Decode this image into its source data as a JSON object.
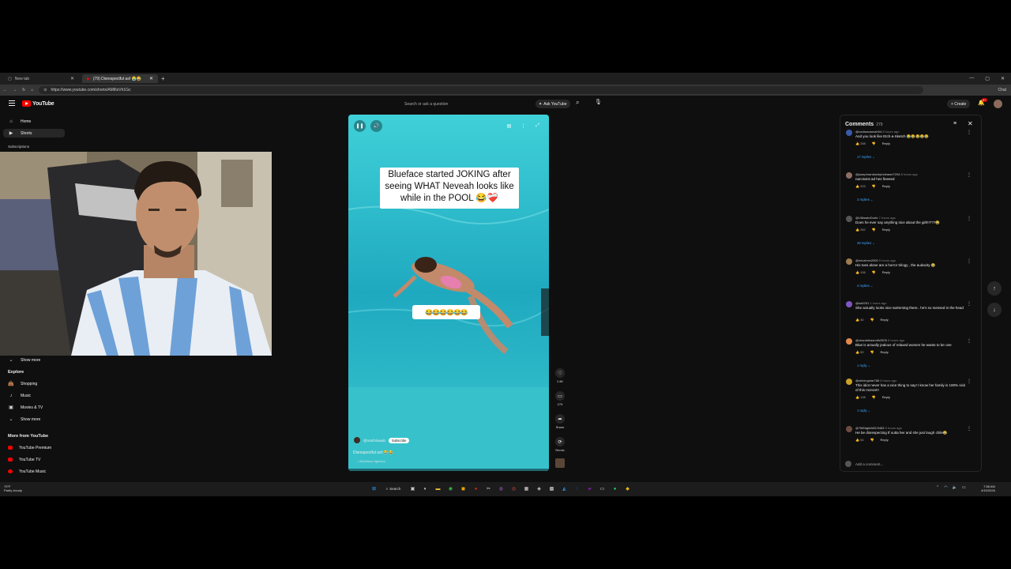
{
  "browser": {
    "tabs": [
      {
        "label": "New tab",
        "active": false
      },
      {
        "label": "(79) Disrespectful asf 😭😂",
        "active": true
      }
    ],
    "url": "https://www.youtube.com/shorts/AMl6sVh1Gc",
    "chat_label": "Chat"
  },
  "header": {
    "logo_text": "YouTube",
    "search_placeholder": "Search or ask a question",
    "ask_label": "Ask YouTube",
    "create_label": "+ Create",
    "notification_count": "9+"
  },
  "sidebar": {
    "top_items": [
      {
        "label": "Home",
        "icon": "home-icon",
        "active": false
      },
      {
        "label": "Shorts",
        "icon": "shorts-icon",
        "active": true
      }
    ],
    "subscriptions_heading": "Subscriptions",
    "show_more_1": "Show more",
    "explore_heading": "Explore",
    "explore_items": [
      {
        "label": "Shopping",
        "icon": "shopping-icon"
      },
      {
        "label": "Music",
        "icon": "music-icon"
      },
      {
        "label": "Movies & TV",
        "icon": "movies-icon"
      }
    ],
    "show_more_2": "Show more",
    "more_heading": "More from YouTube",
    "more_items": [
      {
        "label": "YouTube Premium"
      },
      {
        "label": "YouTube TV"
      },
      {
        "label": "YouTube Music"
      }
    ]
  },
  "short": {
    "caption": "Blueface started JOKING after seeing WHAT Neveah looks like while in the POOL 😂❤️‍🩹",
    "emoji_sticker": "😂😂😂😂😂😂",
    "channel_name": "@notchrisaub",
    "subscribe_label": "Subscribe",
    "title": "Disrespectful asf 😭😂",
    "hashtag": "♪ #blueface #genius",
    "likes": "1.5K",
    "comments_count": "279",
    "share_label": "Share",
    "remix_label": "Remix"
  },
  "comments": {
    "heading": "Comments",
    "count": "279",
    "add_placeholder": "Add a comment...",
    "items": [
      {
        "user": "@coolsavannah04",
        "time": "8 hours ago",
        "text": "And you look like Etch-a-Sketch 😂😂😂😂😂",
        "likes": "258",
        "replies": "17 replies",
        "avatar_color": "#3b5aa8"
      },
      {
        "user": "@josephrandomlyindeasre7294",
        "time": "8 hours ago",
        "text": "narcissist ad hes fineeed",
        "likes": "203",
        "replies": "3 replies",
        "avatar_color": "#8d6e63"
      },
      {
        "user": "@UltimateDurfo",
        "time": "7 hours ago",
        "text": "Does he ever say anything nice about the girl!!!???😂",
        "likes": "262",
        "replies": "38 replies",
        "avatar_color": "#555555"
      },
      {
        "user": "@mizzbmx2000",
        "time": "5 hours ago",
        "text": "His toes alone are a horror trilogy , the audacity 😂",
        "likes": "106",
        "replies": "4 replies",
        "avatar_color": "#9e7b50"
      },
      {
        "user": "@ka9251",
        "time": "1 hours ago",
        "text": "She actually looks nice swimming there.. he's so messed in the head",
        "likes": "30",
        "replies": "",
        "avatar_color": "#7e57c2"
      },
      {
        "user": "@chandrikasmith2505",
        "time": "6 hours ago",
        "text": "Blue is actually jealous of relaxed women he wants to be one",
        "likes": "50",
        "replies": "1 reply",
        "avatar_color": "#e0894a"
      },
      {
        "user": "@shiningstar788",
        "time": "6 hours ago",
        "text": "This idiot never has a nice thing to say! I know her family is 100% sick of this moron!!!",
        "likes": "128",
        "replies": "1 reply",
        "avatar_color": "#c9a227"
      },
      {
        "user": "@7tillNightABC9483",
        "time": "5 hours ago",
        "text": "He be disrespecting tf outta her and she just laugh chile😂",
        "likes": "54",
        "replies": "",
        "avatar_color": "#6d4c41"
      }
    ]
  },
  "taskbar": {
    "weather_temp": "79°F",
    "weather_desc": "Partly cloudy",
    "search_label": "Search",
    "time": "7:58 AM",
    "date": "4/15/2026"
  },
  "colors": {
    "accent": "#ff0000",
    "pool": "#2bbdc8",
    "link": "#3ea6ff"
  }
}
